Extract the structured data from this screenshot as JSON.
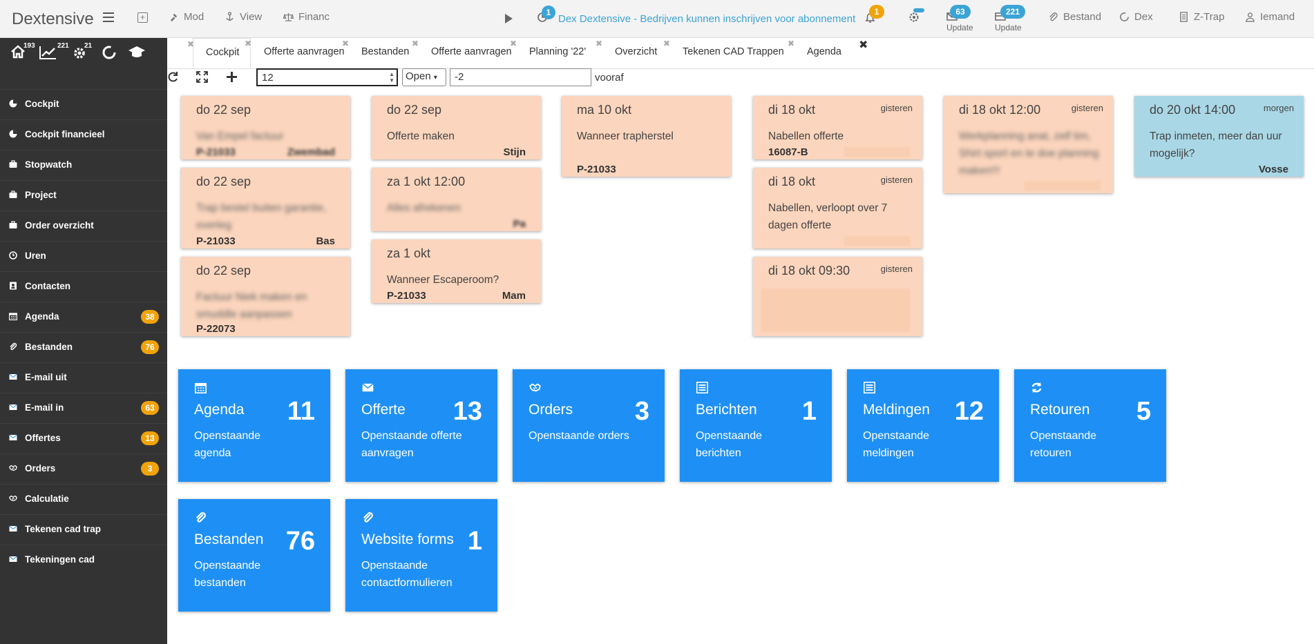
{
  "app": {
    "brand": "Dextensive"
  },
  "topbar": {
    "mod": "Mod",
    "view": "View",
    "financ": "Financ",
    "announce_badge": "1",
    "announcement": "Dex Dextensive - Bedrijven kunnen inschrijven voor abonnement",
    "bell_badge": "1",
    "update1_badge": "63",
    "update1_label": "Update",
    "update2_badge": "221",
    "update2_label": "Update",
    "bestand": "Bestand",
    "dex": "Dex",
    "ztrap": "Z-Trap",
    "user": "Iemand"
  },
  "sidebar": {
    "home_count": "193",
    "chart_count": "221",
    "gear_count": "21",
    "items": [
      {
        "label": "Cockpit",
        "icon": "pie-chart-icon",
        "count": ""
      },
      {
        "label": "Cockpit financieel",
        "icon": "pie-chart-icon",
        "count": ""
      },
      {
        "label": "Stopwatch",
        "icon": "briefcase-icon",
        "count": ""
      },
      {
        "label": "Project",
        "icon": "briefcase-icon",
        "count": ""
      },
      {
        "label": "Order overzicht",
        "icon": "briefcase-icon",
        "count": ""
      },
      {
        "label": "Uren",
        "icon": "clock-icon",
        "count": ""
      },
      {
        "label": "Contacten",
        "icon": "contact-icon",
        "count": ""
      },
      {
        "label": "Agenda",
        "icon": "calendar-icon",
        "count": "38"
      },
      {
        "label": "Bestanden",
        "icon": "paperclip-icon",
        "count": "76"
      },
      {
        "label": "E-mail uit",
        "icon": "envelope-icon",
        "count": ""
      },
      {
        "label": "E-mail in",
        "icon": "envelope-icon",
        "count": "63"
      },
      {
        "label": "Offertes",
        "icon": "envelope-icon",
        "count": "13"
      },
      {
        "label": "Orders",
        "icon": "handshake-icon",
        "count": "3"
      },
      {
        "label": "Calculatie",
        "icon": "handshake-icon",
        "count": ""
      },
      {
        "label": "Tekenen cad trap",
        "icon": "envelope-icon",
        "count": ""
      },
      {
        "label": "Tekeningen cad",
        "icon": "envelope-icon",
        "count": ""
      }
    ]
  },
  "tabs": [
    {
      "label": "Cockpit"
    },
    {
      "label": "Offerte aanvragen"
    },
    {
      "label": "Bestanden"
    },
    {
      "label": "Offerte aanvragen"
    },
    {
      "label": "Planning '22'"
    },
    {
      "label": "Overzicht"
    },
    {
      "label": "Tekenen CAD Trappen"
    },
    {
      "label": "Agenda"
    }
  ],
  "toolbar": {
    "number_value": "12",
    "status_value": "Open",
    "offset_value": "-2",
    "vooraf_label": "vooraf"
  },
  "cards": [
    {
      "date": "do 22 sep",
      "rel": "",
      "text": "Van Empel factuur",
      "text_blurred": true,
      "ref": "P-21033",
      "ref_blurred": true,
      "who": "Zwembad",
      "who_blurred": true
    },
    {
      "date": "do 22 sep",
      "rel": "",
      "text": "Trap bestel buiten garantie, overleg",
      "text_blurred": true,
      "ref": "P-21033",
      "ref_blurred": false,
      "who": "Bas",
      "who_blurred": false
    },
    {
      "date": "do 22 sep",
      "rel": "",
      "text": "Factuur Niek maken en smuddle aanpassen",
      "text_blurred": true,
      "ref": "P-22073",
      "ref_blurred": false,
      "who": "",
      "who_blurred": false
    },
    {
      "date": "do 22 sep",
      "rel": "",
      "text": "Offerte maken",
      "text_blurred": false,
      "ref": "",
      "ref_blurred": false,
      "who": "Stijn",
      "who_blurred": false
    },
    {
      "date": "za 1 okt 12:00",
      "rel": "",
      "text": "Alles afrekenen",
      "text_blurred": true,
      "ref": "",
      "ref_blurred": false,
      "who": "Pa",
      "who_blurred": true
    },
    {
      "date": "za 1 okt",
      "rel": "",
      "text": "Wanneer Escaperoom?",
      "text_blurred": false,
      "ref": "P-21033",
      "ref_blurred": false,
      "who": "Mam",
      "who_blurred": false
    },
    {
      "date": "ma 10 okt",
      "rel": "",
      "text": "Wanneer trapherstel",
      "text_blurred": false,
      "ref": "P-21033",
      "ref_blurred": false,
      "who": "",
      "who_blurred": false
    },
    {
      "date": "di 18 okt",
      "rel": "gisteren",
      "text": "Nabellen offerte",
      "text_blurred": false,
      "ref": "16087-B",
      "ref_blurred": false,
      "who": "",
      "who_blurred": false
    },
    {
      "date": "di 18 okt",
      "rel": "gisteren",
      "text": "Nabellen, verloopt over 7 dagen offerte",
      "text_blurred": false,
      "ref": "",
      "ref_blurred": false,
      "who": "",
      "who_blurred": false
    },
    {
      "date": "di 18 okt 09:30",
      "rel": "gisteren",
      "text": "",
      "text_blurred": false,
      "ref": "",
      "ref_blurred": false,
      "who": "",
      "who_blurred": false
    },
    {
      "date": "di 18 okt 12:00",
      "rel": "gisteren",
      "text": "Werkplanning anat, zelf tim, Shirt sport en te doe planning maken!!!",
      "text_blurred": true,
      "ref": "",
      "ref_blurred": false,
      "who": "",
      "who_blurred": false
    },
    {
      "date": "do 20 okt 14:00",
      "rel": "morgen",
      "text": "Trap inmeten, meer dan uur mogelijk?",
      "text_blurred": false,
      "ref": "",
      "ref_blurred": false,
      "who": "Vosse",
      "who_blurred": false
    }
  ],
  "tiles": [
    {
      "name": "Agenda",
      "count": "11",
      "sub": "Openstaande agenda",
      "icon": "calendar-icon"
    },
    {
      "name": "Offerte",
      "count": "13",
      "sub": "Openstaande offerte aanvragen",
      "icon": "envelope-icon"
    },
    {
      "name": "Orders",
      "count": "3",
      "sub": "Openstaande orders",
      "icon": "handshake-icon"
    },
    {
      "name": "Berichten",
      "count": "1",
      "sub": "Openstaande berichten",
      "icon": "list-icon"
    },
    {
      "name": "Meldingen",
      "count": "12",
      "sub": "Openstaande meldingen",
      "icon": "list-icon"
    },
    {
      "name": "Retouren",
      "count": "5",
      "sub": "Openstaande retouren",
      "icon": "refresh-icon"
    },
    {
      "name": "Bestanden",
      "count": "76",
      "sub": "Openstaande bestanden",
      "icon": "paperclip-icon"
    },
    {
      "name": "Website forms",
      "count": "1",
      "sub": "Openstaande contactformulieren",
      "icon": "paperclip-icon"
    }
  ],
  "colors": {
    "sidebar_bg": "#333333",
    "badge_orange": "#f0a30a",
    "badge_blue": "#3ba4d6",
    "tile_blue": "#1e90f5",
    "card_peach": "#fbd5bd",
    "card_blue": "#a9d7e6"
  }
}
